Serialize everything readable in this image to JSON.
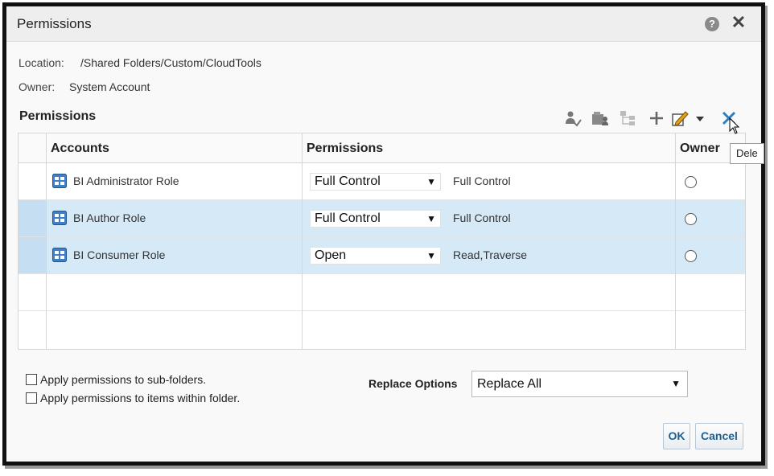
{
  "dialog": {
    "title": "Permissions",
    "help_icon": "?",
    "close_icon": "✕"
  },
  "info": {
    "location_label": "Location:",
    "location_value": "/Shared Folders/Custom/CloudTools",
    "owner_label": "Owner:",
    "owner_value": "System Account"
  },
  "section_title": "Permissions",
  "toolbar": {
    "icons": [
      "add-user-icon",
      "browse-accounts-icon",
      "hierarchy-icon",
      "plus-icon",
      "edit-permission-icon",
      "dropdown-icon",
      "delete-icon"
    ]
  },
  "table": {
    "headers": [
      "Accounts",
      "Permissions",
      "Owner"
    ],
    "rows": [
      {
        "account": "BI Administrator Role",
        "permission": "Full Control",
        "description": "Full Control",
        "selected": false
      },
      {
        "account": "BI Author Role",
        "permission": "Full Control",
        "description": "Full Control",
        "selected": true
      },
      {
        "account": "BI Consumer Role",
        "permission": "Open",
        "description": "Read,Traverse",
        "selected": true
      }
    ]
  },
  "options": {
    "apply_subfolders": "Apply permissions to sub-folders.",
    "apply_items": "Apply permissions to items within folder.",
    "replace_label": "Replace Options",
    "replace_value": "Replace All"
  },
  "buttons": {
    "ok": "OK",
    "cancel": "Cancel"
  },
  "tooltip": "Dele",
  "colors": {
    "selected_row": "#d6e9f7",
    "delete_icon": "#2e7fc1",
    "button_text": "#1f5e8c"
  }
}
